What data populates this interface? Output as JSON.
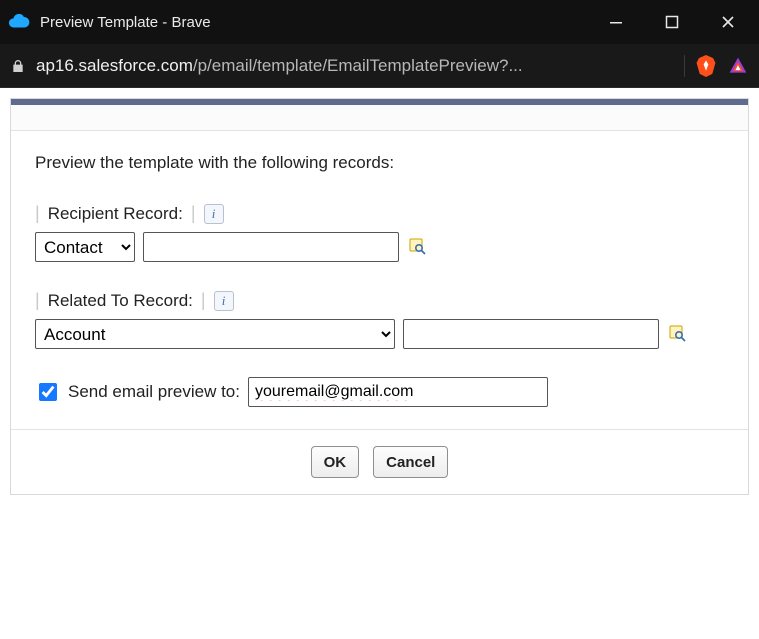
{
  "window": {
    "title": "Preview Template - Brave"
  },
  "address": {
    "host": "ap16.salesforce.com",
    "path": "/p/email/template/EmailTemplatePreview?...",
    "url_display": "ap16.salesforce.com/p/email/template/EmailTemplatePreview?..."
  },
  "icons": {
    "cloud": "cloud-icon",
    "minimize": "minimize-icon",
    "maximize": "maximize-icon",
    "close": "close-icon",
    "lock": "lock-icon",
    "brave": "brave-icon",
    "bat": "bat-icon",
    "info": "i",
    "lookup": "lookup-icon"
  },
  "page": {
    "heading": "Preview the template with the following records:",
    "recipient": {
      "label": "Recipient Record:",
      "selected": "Contact",
      "value": ""
    },
    "related": {
      "label": "Related To Record:",
      "selected": "Account",
      "value": ""
    },
    "send": {
      "checkbox_label": "Send email preview to:",
      "checked": true,
      "email": "youremail@gmail.com"
    },
    "buttons": {
      "ok": "OK",
      "cancel": "Cancel"
    }
  }
}
